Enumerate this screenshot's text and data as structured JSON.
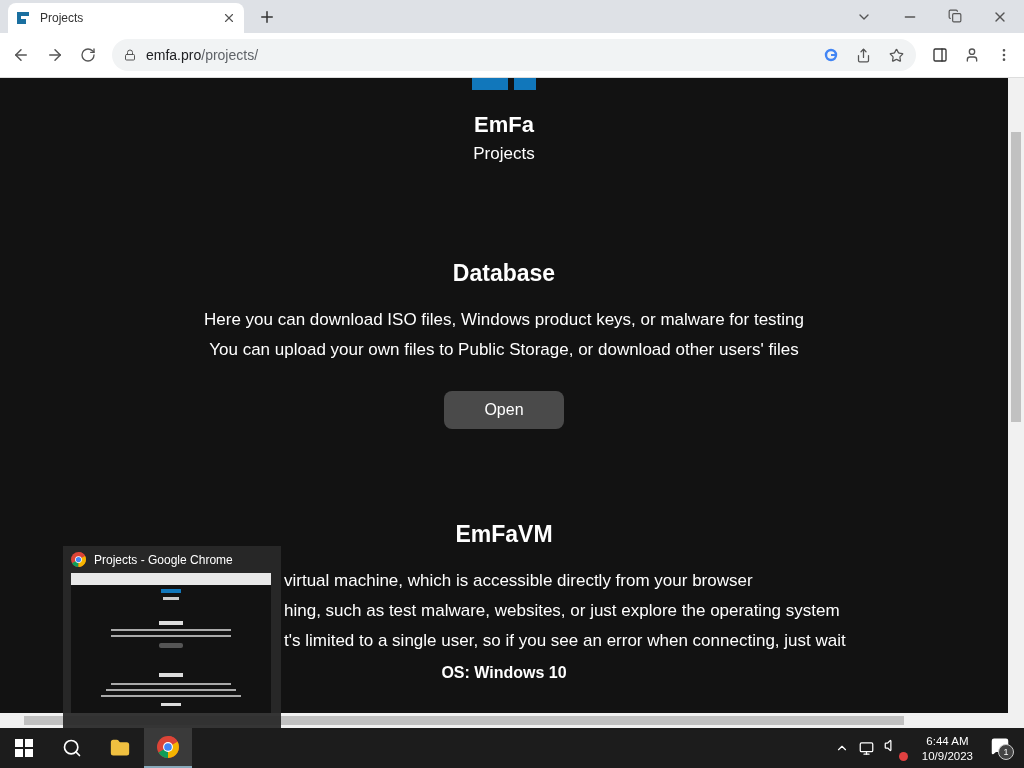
{
  "browser": {
    "tab": {
      "title": "Projects",
      "selected": true
    },
    "url_host": "emfa.pro",
    "url_path": "/projects/"
  },
  "site": {
    "name": "EmFa",
    "subtitle": "Projects"
  },
  "sections": [
    {
      "title": "Database",
      "lines": [
        "Here you can download ISO files, Windows product keys, or malware for testing",
        "You can upload your own files to Public Storage, or download other users' files"
      ],
      "button": "Open"
    },
    {
      "title": "EmFaVM",
      "lines": [
        "virtual machine, which is accessible directly from your browser",
        "hing, such as test malware, websites, or just explore the operating system",
        "t's limited to a single user, so if you see an error when connecting, just wait"
      ],
      "os": "OS: Windows 10"
    }
  ],
  "preview": {
    "title": "Projects - Google Chrome"
  },
  "taskbar": {
    "time": "6:44 AM",
    "date": "10/9/2023",
    "notifications": "1",
    "muted": true
  }
}
